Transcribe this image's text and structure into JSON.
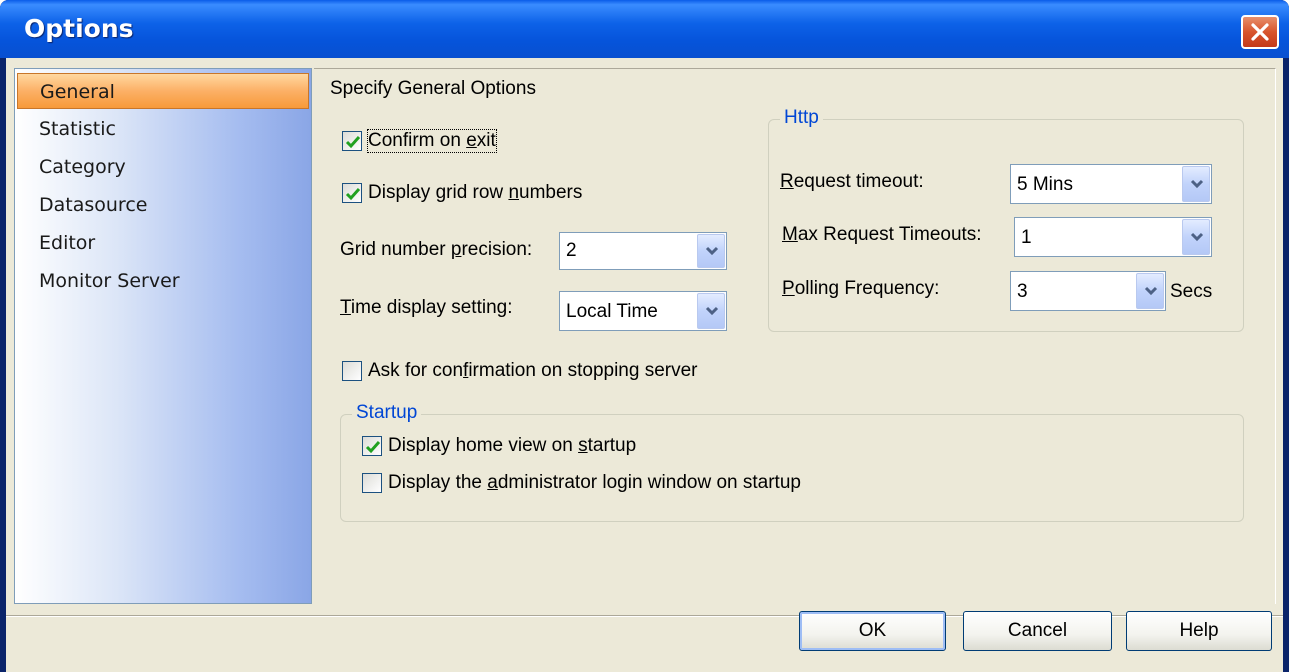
{
  "window": {
    "title": "Options",
    "close_icon": "close-icon"
  },
  "sidebar": {
    "items": [
      {
        "label": "General",
        "active": true
      },
      {
        "label": "Statistic",
        "active": false
      },
      {
        "label": "Category",
        "active": false
      },
      {
        "label": "Datasource",
        "active": false
      },
      {
        "label": "Editor",
        "active": false
      },
      {
        "label": "Monitor Server",
        "active": false
      }
    ]
  },
  "general": {
    "heading": "Specify General Options",
    "confirm_on_exit": {
      "label_pre": "Confirm on ",
      "label_u": "e",
      "label_post": "xit",
      "checked": true
    },
    "display_grid_row_numbers": {
      "label_pre": "Display grid row ",
      "label_u": "n",
      "label_post": "umbers",
      "checked": true
    },
    "grid_precision": {
      "label_pre": "Grid number ",
      "label_u": "p",
      "label_post": "recision:",
      "value": "2"
    },
    "time_display": {
      "label_pre": "",
      "label_u": "T",
      "label_post": "ime display setting:",
      "value": "Local Time"
    },
    "ask_confirm_stop": {
      "label_pre": "Ask for con",
      "label_u": "f",
      "label_post": "irmation on stopping server",
      "checked": false
    }
  },
  "http": {
    "title": "Http",
    "request_timeout": {
      "label_pre": "",
      "label_u": "R",
      "label_post": "equest timeout:",
      "value": "5 Mins"
    },
    "max_request_timeouts": {
      "label_pre": "",
      "label_u": "M",
      "label_post": "ax Request Timeouts:",
      "value": "1"
    },
    "polling_frequency": {
      "label_pre": "",
      "label_u": "P",
      "label_post": "olling Frequency:",
      "value": "3",
      "unit": "Secs"
    }
  },
  "startup": {
    "title": "Startup",
    "display_home_view": {
      "label_pre": "Display home view on ",
      "label_u": "s",
      "label_post": "tartup",
      "checked": true
    },
    "display_admin_login": {
      "label_pre": "Display the ",
      "label_u": "a",
      "label_post": "dministrator login window on startup",
      "checked": false
    }
  },
  "buttons": {
    "ok": "OK",
    "cancel": "Cancel",
    "help": "Help"
  },
  "colors": {
    "titlebar": "#0d62e8",
    "selected_item": "#f79a3a",
    "group_title": "#0046d5",
    "checkmark": "#21a121"
  }
}
